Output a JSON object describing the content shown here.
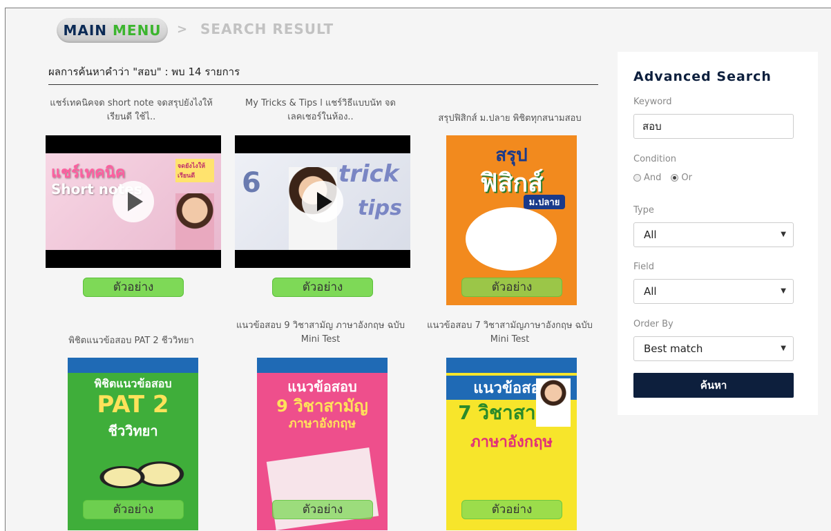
{
  "breadcrumb": {
    "main": "MAIN",
    "menu": "MENU",
    "separator": ">",
    "current": "SEARCH RESULT"
  },
  "results": {
    "heading": "ผลการค้นหาคำว่า \"สอบ\" : พบ 14 รายการ",
    "sample_label": "ตัวอย่าง",
    "items": [
      {
        "title": "แชร์เทคนิคจด short note จดสรุปยังไงให้เรียนดี ใช้ไ..",
        "cover_line1": "แชร์เทคนิค",
        "cover_line2": "Short notes",
        "cover_tag": "จดยังไงให้เรียนดี"
      },
      {
        "title": "My Tricks & Tips l แชร์วิธีแบบนัท จดเลคเชอร์ในห้อง..",
        "cover_line1": "trick",
        "cover_line2": "tips",
        "cover_tag": "6"
      },
      {
        "title": "สรุปฟิสิกส์ ม.ปลาย พิชิตทุกสนามสอบ",
        "cover_line1": "สรุป",
        "cover_line2": "ฟิสิกส์",
        "cover_tag": "ม.ปลาย"
      },
      {
        "title": "พิชิตแนวข้อสอบ PAT 2 ชีววิทยา",
        "cover_line1": "พิชิตแนวข้อสอบ",
        "cover_line2": "PAT 2",
        "cover_tag": "ชีววิทยา"
      },
      {
        "title": "แนวข้อสอบ 9 วิชาสามัญ ภาษาอังกฤษ ฉบับ Mini Test",
        "cover_line1": "แนวข้อสอบ",
        "cover_line2": "9 วิชาสามัญ",
        "cover_tag": "ภาษาอังกฤษ"
      },
      {
        "title": "แนวข้อสอบ 7 วิชาสามัญภาษาอังกฤษ ฉบับ Mini Test",
        "cover_line1": "แนวข้อสอบ",
        "cover_line2": "7 วิชาสามัญ",
        "cover_tag": "ภาษาอังกฤษ"
      }
    ]
  },
  "advanced_search": {
    "title": "Advanced Search",
    "keyword_label": "Keyword",
    "keyword_value": "สอบ",
    "condition_label": "Condition",
    "condition_and": "And",
    "condition_or": "Or",
    "condition_selected": "Or",
    "type_label": "Type",
    "type_value": "All",
    "field_label": "Field",
    "field_value": "All",
    "order_label": "Order By",
    "order_value": "Best match",
    "submit_label": "ค้นหา"
  },
  "colors": {
    "navy": "#0d1f3d",
    "green": "#3cb52e",
    "sample_green": "#7ed957"
  }
}
